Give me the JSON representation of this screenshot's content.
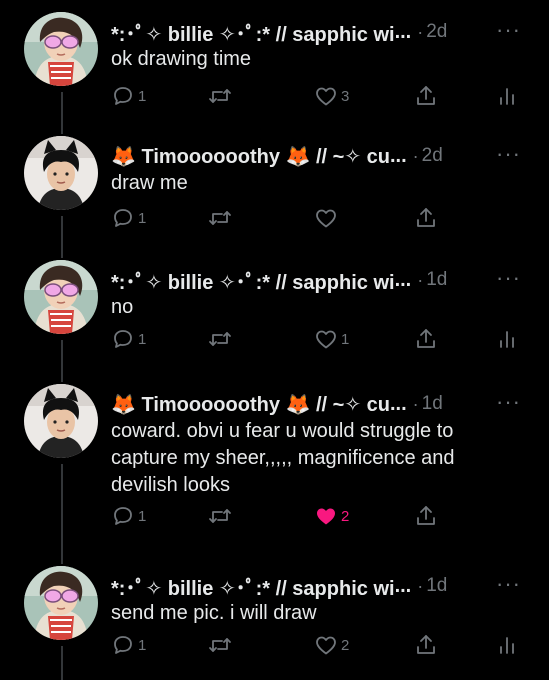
{
  "tweets": [
    {
      "name": "*:･ﾟ✧ billie ✧･ﾟ:* // sapphic wi",
      "time": "2d",
      "text": "ok drawing time",
      "reply_count": "1",
      "retweet_count": "",
      "like_count": "3",
      "liked": false,
      "avatar": "billie-sunglasses-avatar",
      "has_stats": true
    },
    {
      "name": "🦊 Timoooooothy 🦊 // ~✧ cu",
      "time": "2d",
      "text": "draw me",
      "reply_count": "1",
      "retweet_count": "",
      "like_count": "",
      "liked": false,
      "avatar": "timothy-cat-ears-avatar",
      "has_stats": false
    },
    {
      "name": "*:･ﾟ✧ billie ✧･ﾟ:* // sapphic wi",
      "time": "1d",
      "text": "no",
      "reply_count": "1",
      "retweet_count": "",
      "like_count": "1",
      "liked": false,
      "avatar": "billie-sunglasses-avatar",
      "has_stats": true
    },
    {
      "name": "🦊 Timoooooothy 🦊 // ~✧ cu",
      "time": "1d",
      "text": "coward. obvi u fear u would struggle to capture my sheer,,,,, magnificence and devilish looks",
      "reply_count": "1",
      "retweet_count": "",
      "like_count": "2",
      "liked": true,
      "avatar": "timothy-cat-ears-avatar",
      "has_stats": false
    },
    {
      "name": "*:･ﾟ✧ billie ✧･ﾟ:* // sapphic wi",
      "time": "1d",
      "text": "send me pic. i will draw",
      "reply_count": "1",
      "retweet_count": "",
      "like_count": "2",
      "liked": false,
      "avatar": "billie-sunglasses-avatar",
      "has_stats": true
    }
  ],
  "ellipsis": "...",
  "separator": "·",
  "more_glyph": "···",
  "colors": {
    "background": "#000000",
    "text": "#e7e9ea",
    "muted": "#71767b",
    "like_active": "#f91880",
    "thread_line": "#333639"
  }
}
